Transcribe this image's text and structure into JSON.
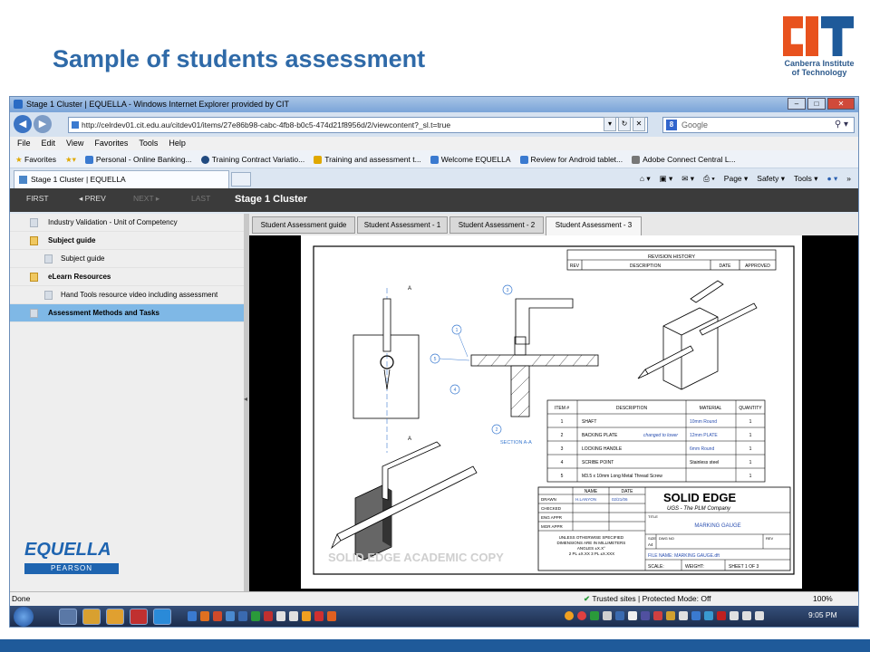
{
  "slide": {
    "title": "Sample of students assessment",
    "logo_text": "Canberra Institute\nof Technology",
    "colors": {
      "title": "#2f6aa8",
      "logo_orange": "#e8521e",
      "logo_blue": "#1e5a9a",
      "footer_bar": "#1f5a9a"
    }
  },
  "browser": {
    "window_title": "Stage 1 Cluster | EQUELLA - Windows Internet Explorer provided by CIT",
    "address": "http://celrdev01.cit.edu.au/citdev01/items/27e86b98-cabc-4fb8-b0c5-474d21f8956d/2/viewcontent?_sl.t=true",
    "search_placeholder": "Google",
    "menu": [
      "File",
      "Edit",
      "View",
      "Favorites",
      "Tools",
      "Help"
    ],
    "favorites_label": "Favorites",
    "favorites": [
      "Personal - Online Banking...",
      "Training Contract Variatio...",
      "Training and assessment t...",
      "Welcome EQUELLA",
      "Review for Android tablet...",
      "Adobe Connect Central L..."
    ],
    "tab_label": "Stage 1 Cluster | EQUELLA",
    "command_bar": [
      "Page ▾",
      "Safety ▾",
      "Tools ▾"
    ],
    "status_left": "Done",
    "status_zone": "Trusted sites | Protected Mode: Off",
    "zoom": "100%",
    "clock": "9:05 PM"
  },
  "equella": {
    "nav": {
      "first": "FIRST",
      "prev": "◂ PREV",
      "next": "NEXT ▸",
      "last": "LAST"
    },
    "heading": "Stage 1 Cluster",
    "tree": [
      {
        "label": "Industry Validation - Unit of Competency",
        "type": "doc",
        "indent": 0,
        "bold": false,
        "selected": false
      },
      {
        "label": "Subject guide",
        "type": "folder",
        "indent": 0,
        "bold": true,
        "selected": false
      },
      {
        "label": "Subject guide",
        "type": "doc",
        "indent": 1,
        "bold": false,
        "selected": false
      },
      {
        "label": "eLearn Resources",
        "type": "folder",
        "indent": 0,
        "bold": true,
        "selected": false
      },
      {
        "label": "Hand Tools resource video including assessment",
        "type": "doc",
        "indent": 1,
        "bold": false,
        "selected": false
      },
      {
        "label": "Assessment Methods and Tasks",
        "type": "doc",
        "indent": 0,
        "bold": true,
        "selected": true
      }
    ],
    "logo": "EQUELLA",
    "logo_sub": "PEARSON",
    "tabs": [
      "Student Assessment guide",
      "Student Assessment - 1",
      "Student Assessment - 2",
      "Student Assessment - 3"
    ],
    "active_tab": 3
  },
  "drawing": {
    "revision_history": "REVISION HISTORY",
    "rev_headers": [
      "REV",
      "DESCRIPTION",
      "DATE",
      "APPROVED"
    ],
    "section_label": "SECTION A-A",
    "balloons": [
      "1",
      "2",
      "3",
      "4",
      "5"
    ],
    "section_marks": [
      "A",
      "A"
    ],
    "bom_headers": [
      "ITEM #",
      "DESCRIPTION",
      "MATERIAL",
      "QUANTITY"
    ],
    "bom_rows": [
      {
        "item": "1",
        "desc": "SHAFT",
        "material": "10mm Round",
        "qty": "1"
      },
      {
        "item": "2",
        "desc": "BACKING PLATE",
        "material": "12mm PLATE",
        "qty": "1"
      },
      {
        "item": "3",
        "desc": "LOCKING HANDLE",
        "material": "6mm Round",
        "qty": "1"
      },
      {
        "item": "4",
        "desc": "SCRIBE POINT",
        "material": "Stainless steel",
        "qty": "1"
      },
      {
        "item": "5",
        "desc": "M3.5 x 10mm Long Metal Thread Screw",
        "material": "",
        "qty": "1"
      }
    ],
    "handwritten_note": "changed to lower",
    "title_block": {
      "labels": [
        "DRAWN",
        "CHECKED",
        "ENG APPR",
        "MGR APPR"
      ],
      "name_header": "NAME",
      "date_header": "DATE",
      "drawn_by": "H.LANYON",
      "drawn_date": "02/21/06",
      "tolerance": "UNLESS OTHERWISE SPECIFIED\nDIMENSIONS ARE IN MILLIMETERS\nANGLES ±X.X°\n2 PL ±X.XX 3 PL ±X.XXX",
      "company": "SOLID EDGE",
      "company_sub": "UGS - The PLM Company",
      "title_label": "TITLE",
      "title": "MARKING GAUGE",
      "size_label": "SIZE",
      "size": "A4",
      "dwg_label": "DWG NO",
      "rev_label": "REV",
      "file_name": "FILE NAME: MARKING GAUGE.dft",
      "scale": "SCALE:",
      "weight": "WEIGHT:",
      "sheet": "SHEET 1 OF 3",
      "watermark": "SOLID EDGE ACADEMIC COPY"
    }
  }
}
